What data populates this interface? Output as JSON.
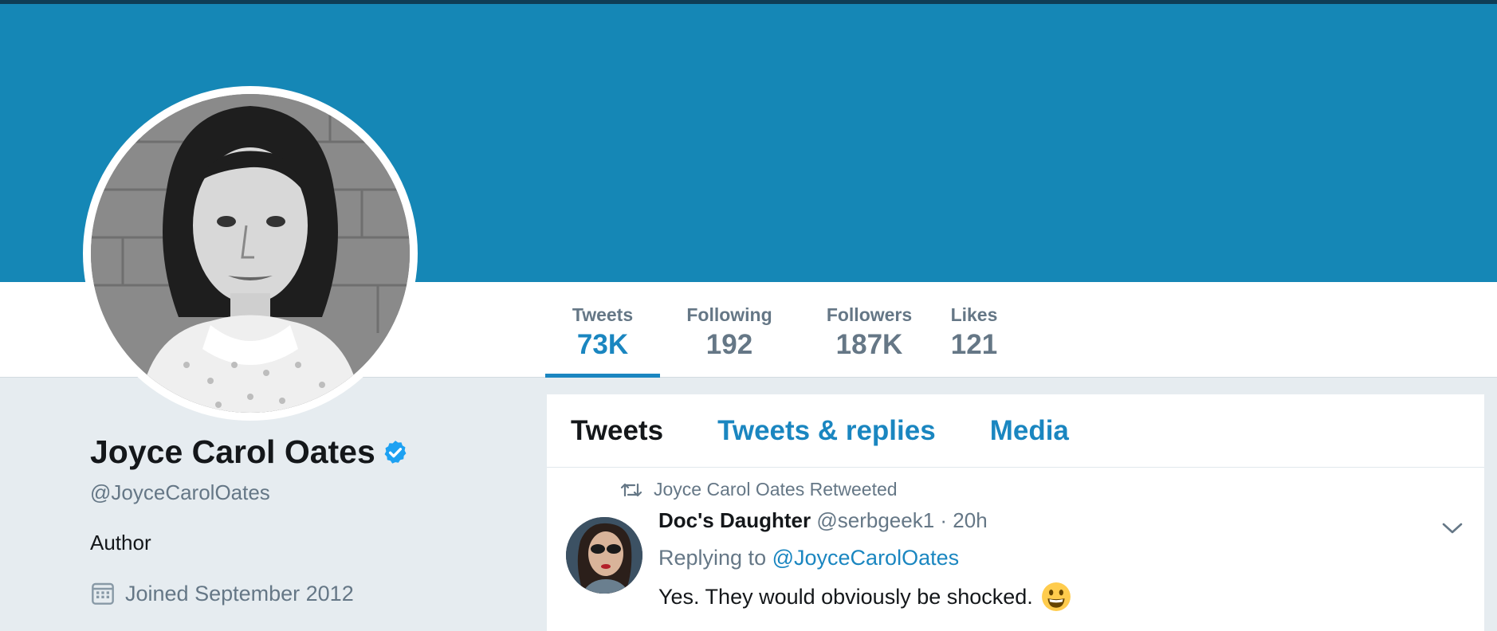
{
  "banner": {
    "color": "#1587b6"
  },
  "stats": [
    {
      "label": "Tweets",
      "value": "73K",
      "active": true
    },
    {
      "label": "Following",
      "value": "192",
      "active": false
    },
    {
      "label": "Followers",
      "value": "187K",
      "active": false
    },
    {
      "label": "Likes",
      "value": "121",
      "active": false
    }
  ],
  "profile": {
    "name": "Joyce Carol Oates",
    "verified": true,
    "handle": "@JoyceCarolOates",
    "bio": "Author",
    "joined": "Joined September 2012",
    "joined_icon": "calendar-icon"
  },
  "tabs": [
    {
      "label": "Tweets",
      "active": true
    },
    {
      "label": "Tweets & replies",
      "active": false
    },
    {
      "label": "Media",
      "active": false
    }
  ],
  "tweet": {
    "retweet_label": "Joyce Carol Oates Retweeted",
    "author": "Doc's Daughter",
    "handle": "@serbgeek1",
    "time": "· 20h",
    "replying_prefix": "Replying to",
    "replying_handle": "@JoyceCarolOates",
    "text": "Yes. They would obviously be shocked.",
    "emoji": "smiling-face-emoji"
  },
  "colors": {
    "accent": "#1a86c0",
    "verified": "#1da1f2",
    "muted": "#657786"
  }
}
